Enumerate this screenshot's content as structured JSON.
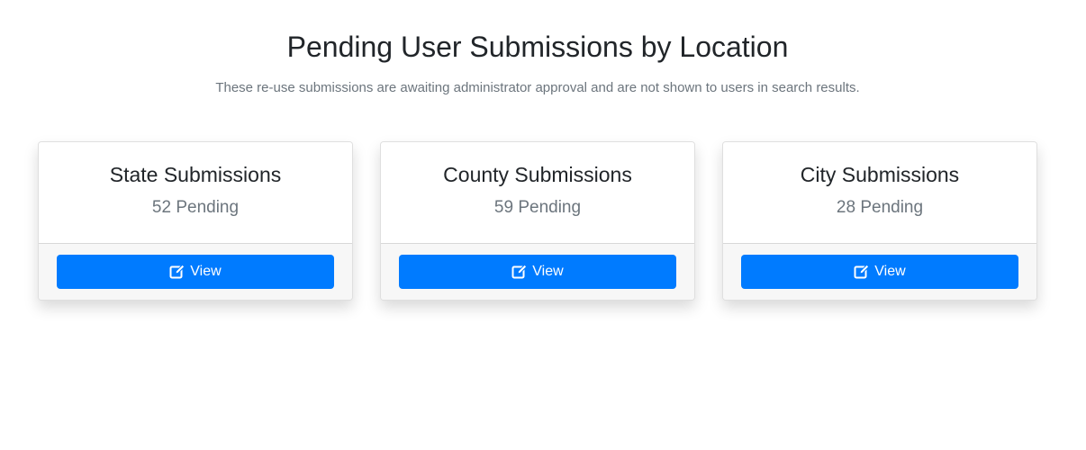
{
  "header": {
    "title": "Pending User Submissions by Location",
    "subtitle": "These re-use submissions are awaiting administrator approval and are not shown to users in search results."
  },
  "cards": [
    {
      "title": "State Submissions",
      "count": "52 Pending",
      "button_label": "View",
      "button_icon": "edit-icon"
    },
    {
      "title": "County Submissions",
      "count": "59 Pending",
      "button_label": "View",
      "button_icon": "edit-icon"
    },
    {
      "title": "City Submissions",
      "count": "28 Pending",
      "button_label": "View",
      "button_icon": "edit-icon"
    }
  ],
  "colors": {
    "primary": "#007bff",
    "muted": "#6c757d",
    "footer_bg": "#f7f7f7"
  }
}
